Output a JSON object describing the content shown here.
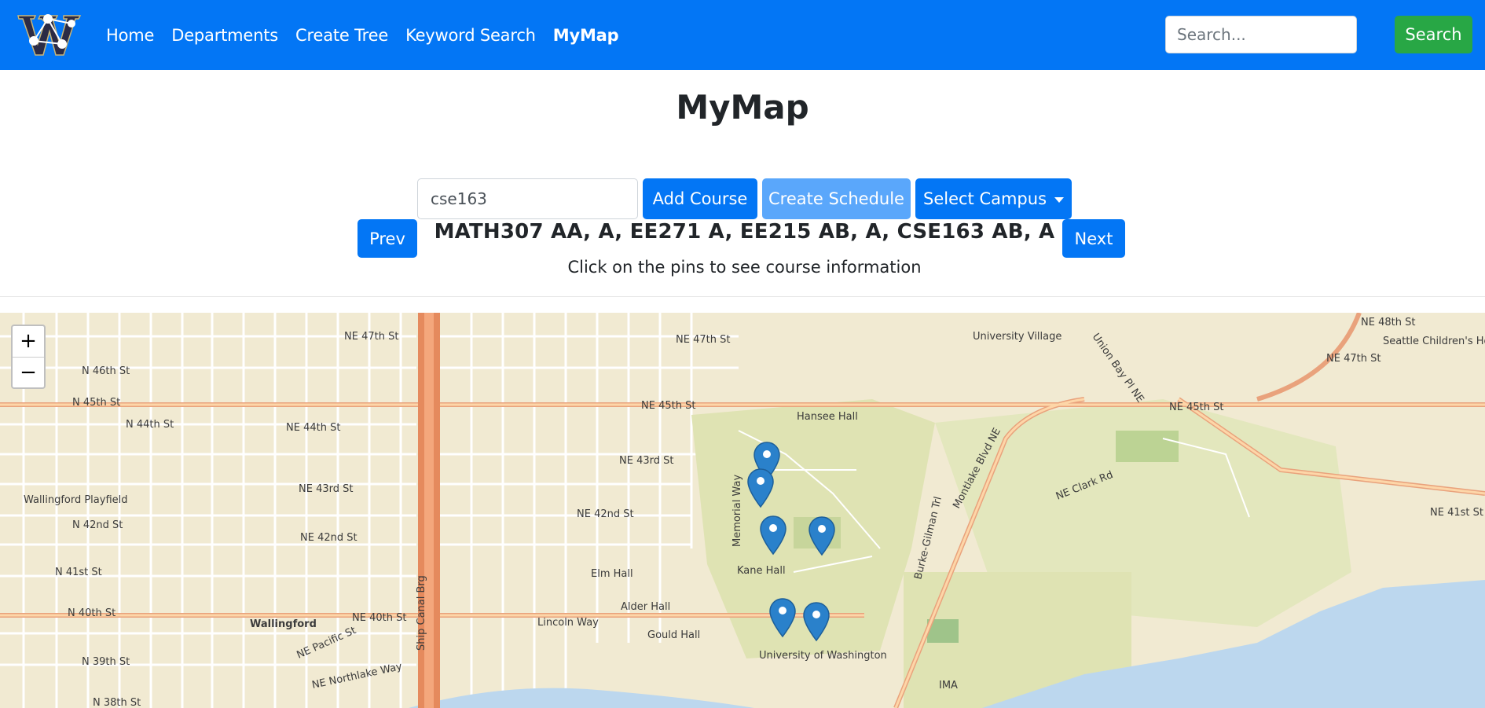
{
  "nav": {
    "links": [
      "Home",
      "Departments",
      "Create Tree",
      "Keyword Search",
      "MyMap"
    ],
    "search_placeholder": "Search...",
    "search_button": "Search"
  },
  "page": {
    "title": "MyMap",
    "course_input_value": "cse163",
    "add_course_label": "Add Course",
    "create_schedule_label": "Create Schedule",
    "select_campus_label": "Select Campus",
    "prev_label": "Prev",
    "next_label": "Next",
    "schedule_text": "MATH307 AA, A, EE271 A, EE215 AB, A, CSE163 AB, A",
    "hint_text": "Click on the pins to see course information"
  },
  "map": {
    "zoom_in": "+",
    "zoom_out": "−",
    "labels": {
      "ne47": "NE 47th St",
      "ne47b": "NE 47th St",
      "n46": "N 46th St",
      "n45": "N 45th St",
      "ne45": "NE 45th St",
      "ne45b": "NE 45th St",
      "n44": "N 44th St",
      "ne44": "NE 44th St",
      "ne43": "NE 43rd St",
      "ne43b": "NE 43rd St",
      "n42": "N 42nd St",
      "ne42": "NE 42nd St",
      "ne42b": "NE 42nd St",
      "n41": "N 41st St",
      "ne41": "NE 41st St",
      "n40": "N 40th St",
      "ne40": "NE 40th St",
      "n39": "N 39th St",
      "n38": "N 38th St",
      "wallingford": "Wallingford",
      "wallingford_playfield": "Wallingford Playfield",
      "lincoln": "Lincoln Way",
      "hansee": "Hansee Hall",
      "kane": "Kane Hall",
      "elm": "Elm Hall",
      "alder": "Alder Hall",
      "gould": "Gould Hall",
      "uw": "University of Washington",
      "univ_village": "University Village",
      "seattle_childrens": "Seattle Children's Hospital",
      "montlake": "Montlake Blvd NE",
      "clark": "NE Clark Rd",
      "ship_canal": "Ship Canal Brg",
      "memorial": "Memorial Way",
      "burke_gilman": "Burke-Gilman Trl",
      "ne_pacific": "NE Pacific St",
      "ne_northlake": "NE Northlake Way",
      "union_bay": "Union Bay Pl NE",
      "ima": "IMA",
      "ne48": "NE 48th St",
      "ne47c": "NE 47th St"
    }
  },
  "colors": {
    "primary": "#0376f5",
    "success": "#28a745",
    "pin": "#2a81cb"
  }
}
